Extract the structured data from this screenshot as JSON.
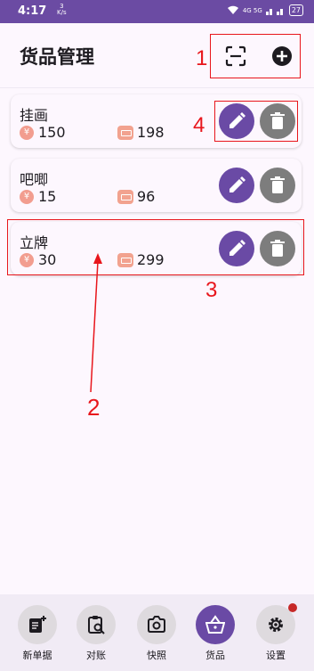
{
  "status": {
    "time": "4:17",
    "speed_value": "3",
    "speed_unit": "K/s",
    "signal_text": "4G  5G",
    "battery": "27"
  },
  "appbar": {
    "title": "货品管理"
  },
  "items": [
    {
      "name": "挂画",
      "price": "150",
      "stock": "198"
    },
    {
      "name": "吧唧",
      "price": "15",
      "stock": "96"
    },
    {
      "name": "立牌",
      "price": "30",
      "stock": "299"
    }
  ],
  "price_symbol": "¥",
  "annotations": {
    "l1": "1",
    "l2": "2",
    "l3": "3",
    "l4": "4"
  },
  "nav": [
    {
      "label": "新单据",
      "icon": "new-doc-icon"
    },
    {
      "label": "对账",
      "icon": "clipboard-search-icon"
    },
    {
      "label": "快照",
      "icon": "camera-icon"
    },
    {
      "label": "货品",
      "icon": "basket-icon"
    },
    {
      "label": "设置",
      "icon": "gear-icon"
    }
  ],
  "colors": {
    "primary": "#6a4aa5",
    "status_bar": "#6b4ba3",
    "delete": "#7d7d7d",
    "annotation": "#e8161c",
    "background": "#fdf7fe"
  }
}
